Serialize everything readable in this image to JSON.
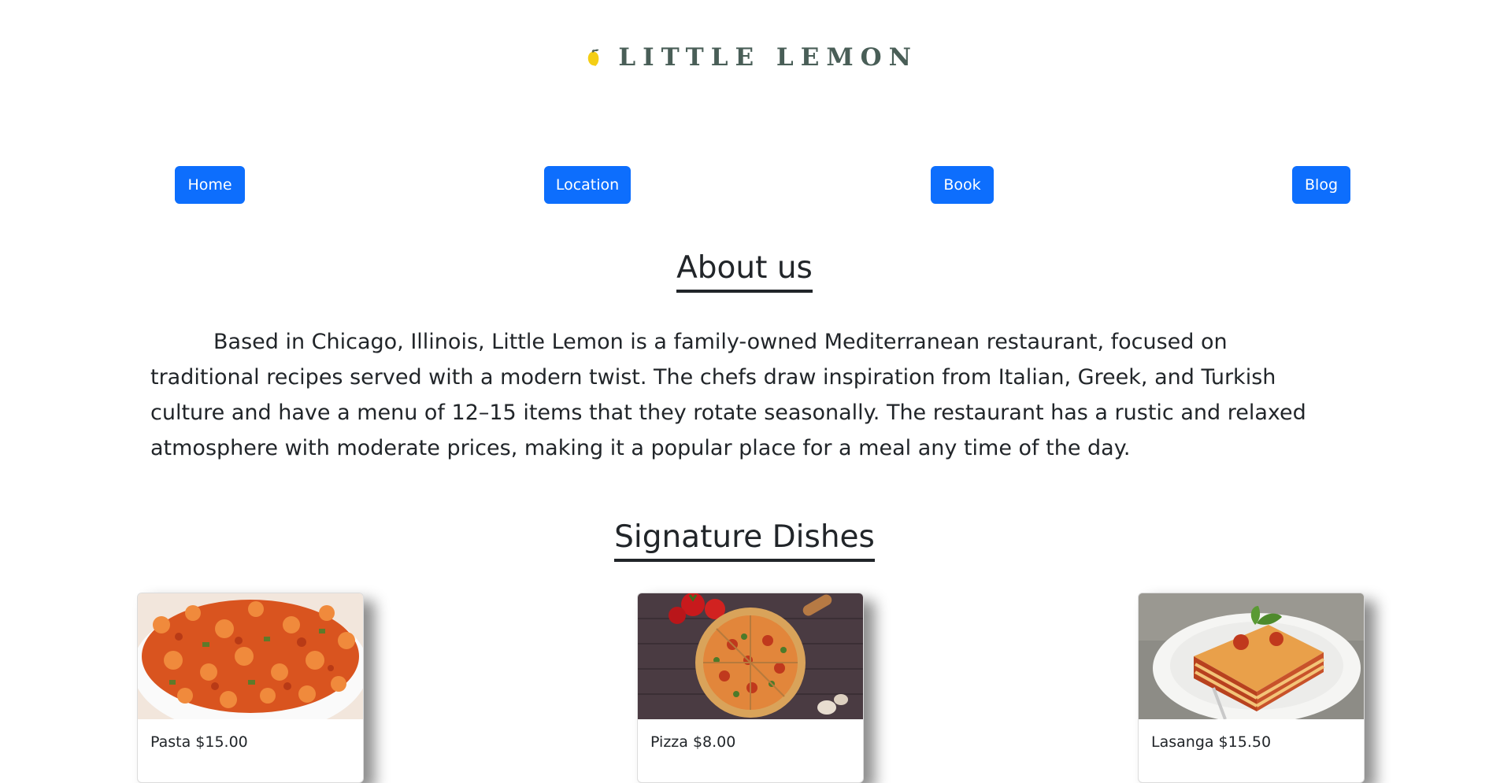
{
  "brand": {
    "name": "LITTLE LEMON",
    "logo_icon": "lemon-icon",
    "text_color": "#495e57",
    "lemon_color": "#f4ce14"
  },
  "nav": {
    "accent": "#0d6efd",
    "items": [
      {
        "label": "Home"
      },
      {
        "label": "Location"
      },
      {
        "label": "Book"
      },
      {
        "label": "Blog"
      }
    ]
  },
  "about": {
    "title": "About us",
    "text": "Based in Chicago, Illinois, Little Lemon is a family-owned Mediterranean restaurant, focused on traditional recipes served with a modern twist. The chefs draw inspiration from Italian, Greek, and Turkish culture and have a menu of 12–15 items that they rotate seasonally. The restaurant has a rustic and relaxed atmosphere with moderate prices, making it a popular place for a meal any time of the day."
  },
  "dishes": {
    "title": "Signature Dishes",
    "items": [
      {
        "caption": "Pasta $15.00",
        "image": "pasta-photo"
      },
      {
        "caption": "Pizza $8.00",
        "image": "pizza-photo"
      },
      {
        "caption": "Lasanga $15.50",
        "image": "lasagna-photo"
      }
    ]
  }
}
